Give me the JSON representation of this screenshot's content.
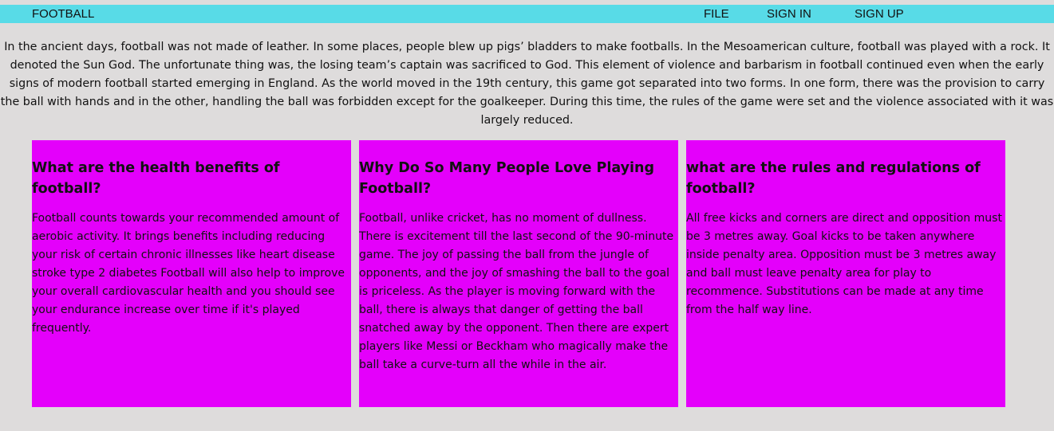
{
  "navbar": {
    "brand": "FOOTBALL",
    "links": {
      "file": "FILE",
      "sign_in": "SIGN IN",
      "sign_up": "SIGN UP"
    }
  },
  "intro": {
    "text": "In the ancient days, football was not made of leather. In some places, people blew up pigs’ bladders to make footballs. In the Mesoamerican culture, football was played with a rock. It denoted the Sun God. The unfortunate thing was, the losing team’s captain was sacrificed to God. This element of violence and barbarism in football continued even when the early signs of modern football started emerging in England.  As the world moved in the 19th century, this game got separated into two forms. In one form, there was the provision to carry the ball with hands and in the other, handling the ball was forbidden except for the goalkeeper. During this time, the rules of the game were set and the violence associated with it was largely reduced."
  },
  "cards": [
    {
      "title": "What are the health benefits of football?",
      "body": "Football counts towards your recommended amount of aerobic activity. It brings benefits including reducing your risk of certain chronic illnesses like heart disease stroke type 2 diabetes Football will also help to improve your overall cardiovascular health and you should see your endurance increase over time if it's played frequently."
    },
    {
      "title": "Why Do So Many People Love Playing Football?",
      "body": "Football, unlike cricket, has no moment of dullness. There is excitement till the last second of the 90-minute game. The joy of passing the ball from the jungle of opponents, and the joy of smashing the ball to the goal is priceless. As the player is moving forward with the ball, there is always that danger of getting the ball snatched away by the opponent. Then there are expert players like Messi or Beckham who magically make the ball take a curve-turn all the while in the air."
    },
    {
      "title": "what are the rules and regulations of football?",
      "body": "All free kicks and corners are direct and opposition must be 3 metres away. Goal kicks to be taken anywhere inside penalty area. Opposition must be 3 metres away and ball must leave penalty area for play to recommence. Substitutions can be made at any time from the half way line."
    }
  ],
  "colors": {
    "background": "#dedcdc",
    "navbar": "#58dbe7",
    "card": "#e400fb",
    "text": "#111111"
  }
}
